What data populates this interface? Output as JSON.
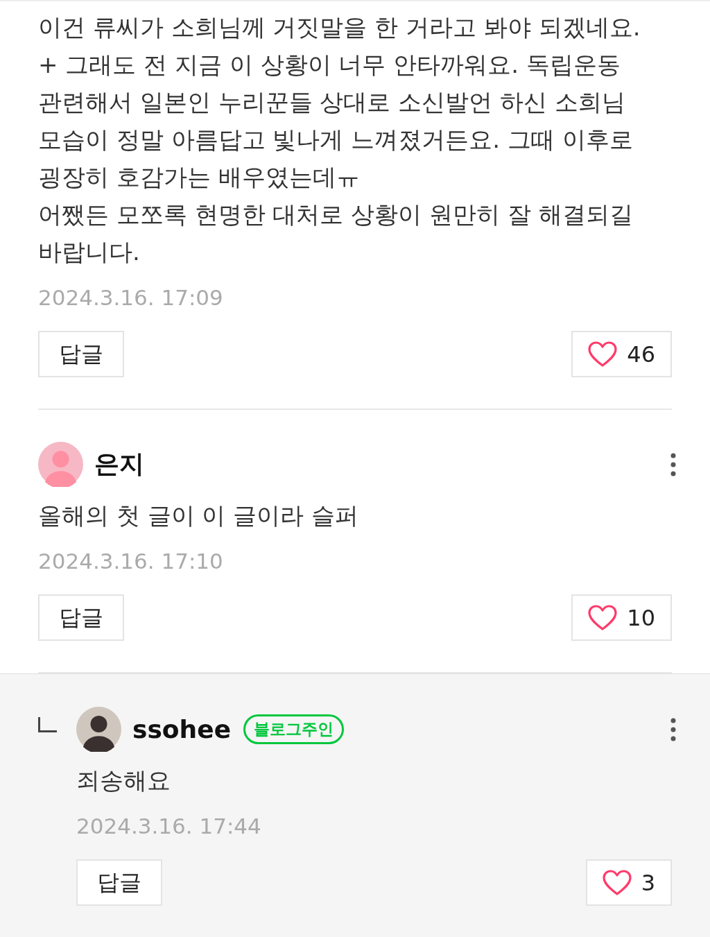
{
  "comments": [
    {
      "kind": "comment",
      "text_lines": [
        "이건 류씨가 소희님께 거짓말을 한 거라고 봐야 되겠네요.",
        "+ 그래도 전 지금 이 상황이 너무 안타까워요. 독립운동",
        "관련해서 일본인 누리꾼들 상대로 소신발언 하신 소희님",
        "모습이 정말 아름답고 빛나게 느껴졌거든요. 그때 이후로",
        "굉장히 호감가는 배우였는데ㅠ",
        "어쨌든 모쪼록 현명한 대처로 상황이 원만히 잘 해결되길",
        "바랍니다."
      ],
      "date": "2024.3.16. 17:09",
      "reply_button": "답글",
      "likes": "46"
    },
    {
      "kind": "comment",
      "author": "은지",
      "text_lines": [
        "올해의 첫 글이 이 글이라 슬퍼"
      ],
      "date": "2024.3.16. 17:10",
      "reply_button": "답글",
      "likes": "10"
    },
    {
      "kind": "reply",
      "author": "ssohee",
      "badge": "블로그주인",
      "text_lines": [
        "죄송해요"
      ],
      "date": "2024.3.16. 17:44",
      "reply_button": "답글",
      "likes": "3"
    }
  ]
}
